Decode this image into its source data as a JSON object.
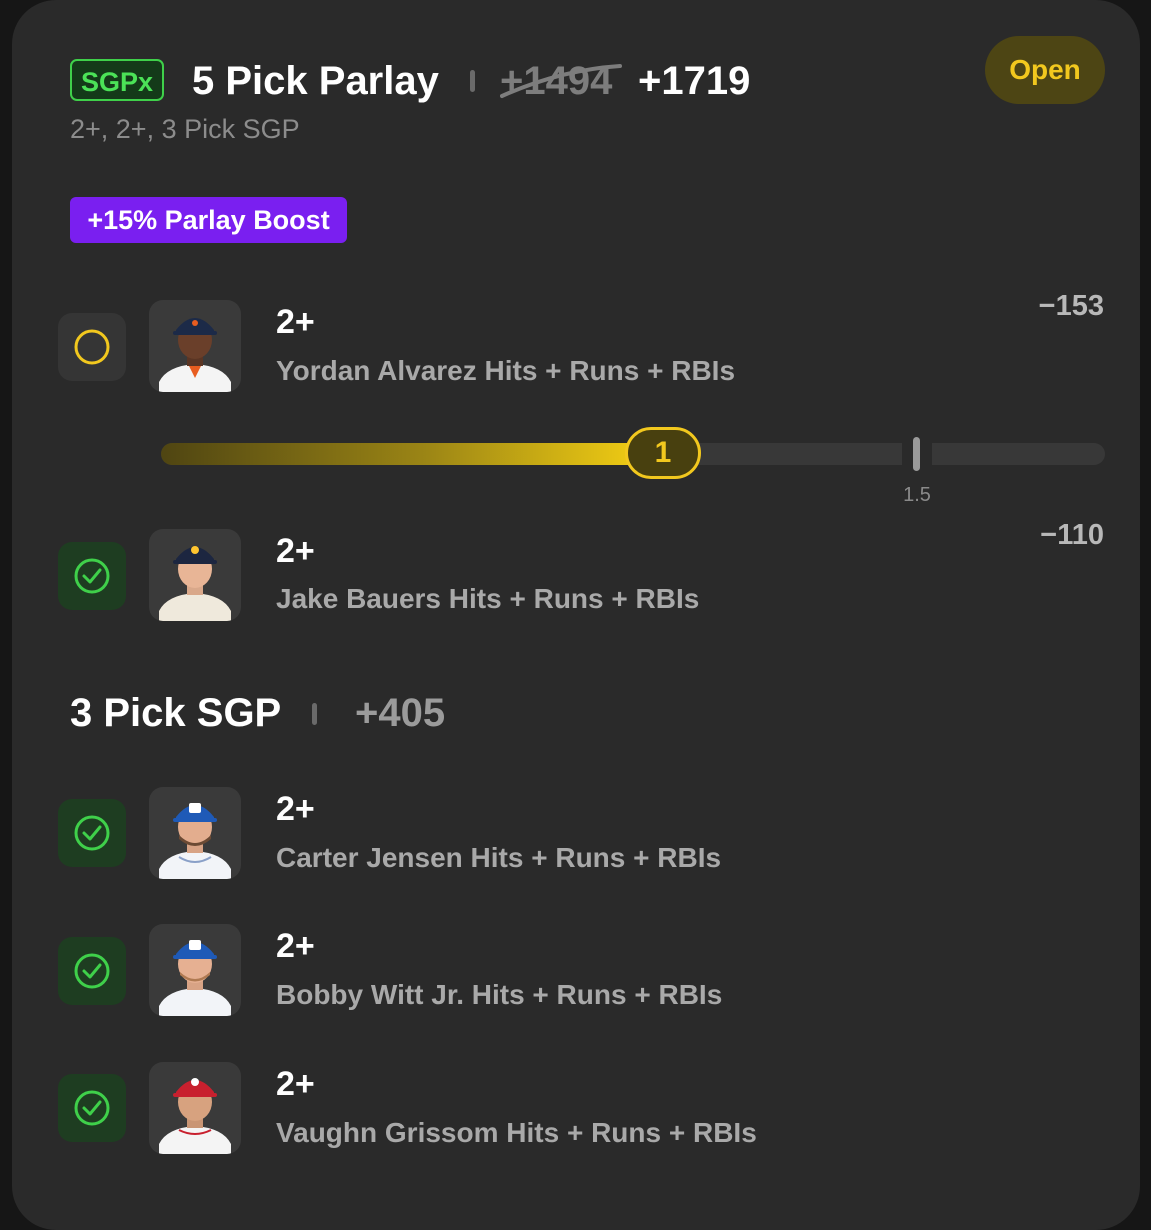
{
  "card": {
    "badge": "SGPx",
    "title": "5 Pick Parlay",
    "original_odds": "+1494",
    "boosted_odds": "+1719",
    "subtitle": "2+, 2+, 3 Pick SGP",
    "status": "Open",
    "boost_label": "+15% Parlay Boost"
  },
  "legs": [
    {
      "line": "2+",
      "market": "Yordan Alvarez Hits + Runs + RBIs",
      "odds": "−153",
      "status": "pending",
      "icon": "circle-icon",
      "progress": {
        "current_label": "1",
        "current": 1,
        "target_label": "1.5",
        "target": 1.5
      }
    },
    {
      "line": "2+",
      "market": "Jake Bauers Hits + Runs + RBIs",
      "odds": "−110",
      "status": "won",
      "icon": "check-circle-icon"
    }
  ],
  "sgp": {
    "title": "3 Pick SGP",
    "odds": "+405",
    "legs": [
      {
        "line": "2+",
        "market": "Carter Jensen Hits + Runs + RBIs",
        "status": "won",
        "icon": "check-circle-icon"
      },
      {
        "line": "2+",
        "market": "Bobby Witt Jr. Hits + Runs + RBIs",
        "status": "won",
        "icon": "check-circle-icon"
      },
      {
        "line": "2+",
        "market": "Vaughn Grissom Hits + Runs + RBIs",
        "status": "won",
        "icon": "check-circle-icon"
      }
    ]
  },
  "colors": {
    "accent_yellow": "#f2c81e",
    "won_green": "#3fd04a",
    "boost_purple": "#7a1ff0",
    "card_bg": "#2a2a2a"
  }
}
